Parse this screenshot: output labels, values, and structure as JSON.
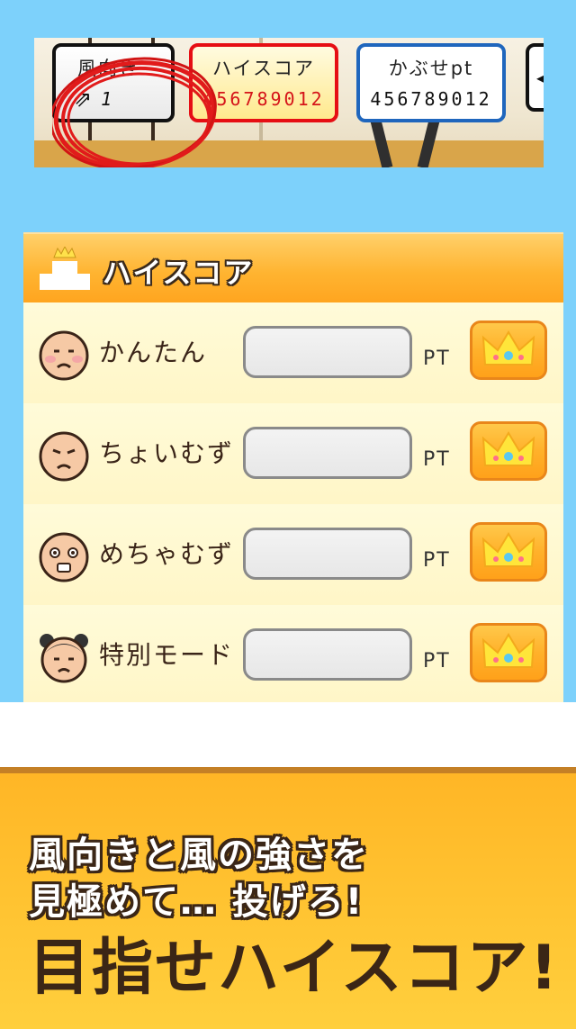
{
  "hud": {
    "wind": {
      "label": "風向き",
      "value": "1",
      "arrow_icon": "arrow-up-right"
    },
    "high_score": {
      "label": "ハイスコア",
      "value": "456789012",
      "color": "#d51419"
    },
    "kabuse_pt": {
      "label": "かぶせpt",
      "value": "456789012"
    },
    "menu_icon": "chevron-left"
  },
  "panel": {
    "title": "ハイスコア",
    "header_icon": "podium-crown",
    "unit": "PT",
    "rows": [
      {
        "label": "かんたん",
        "value": "",
        "face": "easy-face"
      },
      {
        "label": "ちょいむず",
        "value": "",
        "face": "medium-face"
      },
      {
        "label": "めちゃむず",
        "value": "",
        "face": "hard-face"
      },
      {
        "label": "特別モード",
        "value": "",
        "face": "special-face"
      }
    ],
    "ranking_icon": "crown"
  },
  "banner": {
    "line1": "風向きと風の強さを",
    "line2": "見極めて… 投げろ!",
    "line3": "目指せハイスコア!"
  },
  "colors": {
    "sky": "#7dd1fb",
    "accent_orange": "#ffb431",
    "dark_brown": "#3b2616"
  }
}
